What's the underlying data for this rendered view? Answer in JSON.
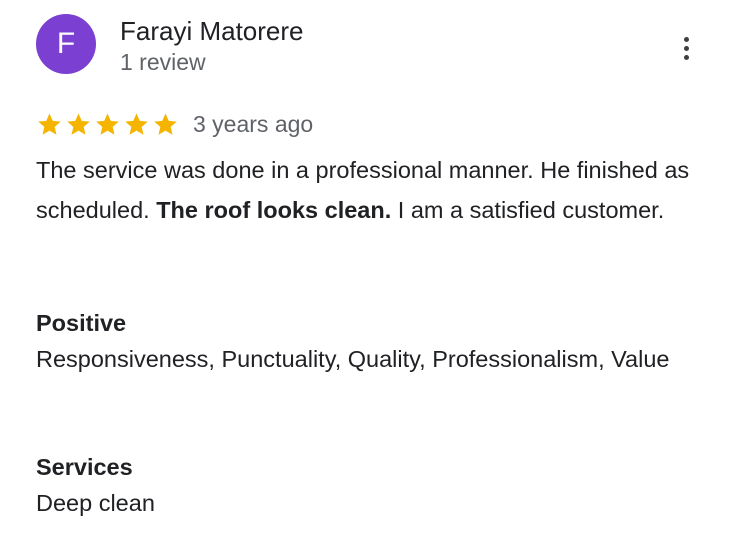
{
  "reviewer": {
    "initial": "F",
    "avatar_color": "#7b3fd1",
    "name": "Farayi Matorere",
    "review_count": "1 review"
  },
  "menu": {
    "icon": "more-vert-icon"
  },
  "rating": {
    "stars": 5,
    "max_stars": 5,
    "star_color": "#f4b400",
    "age": "3 years ago"
  },
  "review": {
    "text_part1": "The service was done in a professional manner. He finished as scheduled. ",
    "text_bold": "The roof looks clean.",
    "text_part2": " I am a satisfied customer."
  },
  "positive": {
    "title": "Positive",
    "value": "Responsiveness, Punctuality, Quality, Professionalism, Value"
  },
  "services": {
    "title": "Services",
    "value": "Deep clean"
  }
}
